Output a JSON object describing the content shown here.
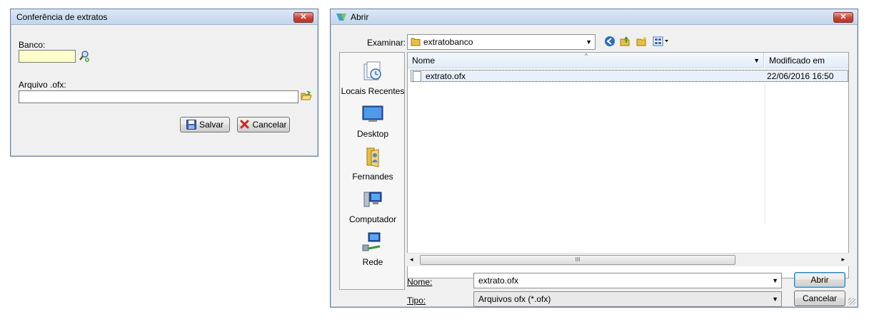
{
  "dialog1": {
    "title": "Conferência de extratos",
    "close": "✕",
    "banco_label": "Banco:",
    "banco_value": "",
    "arquivo_label": "Arquivo .ofx:",
    "arquivo_value": "",
    "save_label": "Salvar",
    "cancel_label": "Cancelar"
  },
  "dialog2": {
    "title": "Abrir",
    "close": "✕",
    "examinar_label": "Examinar:",
    "folder": "extratobanco",
    "places": [
      "Locais Recentes",
      "Desktop",
      "Fernandes",
      "Computador",
      "Rede"
    ],
    "columns": {
      "name": "Nome",
      "modified": "Modificado em"
    },
    "files": [
      {
        "name": "extrato.ofx",
        "modified": "22/06/2016 16:50"
      }
    ],
    "hscroll_grip": "III",
    "name_label": "Nome:",
    "name_value": "extrato.ofx",
    "type_label": "Tipo:",
    "type_value": "Arquivos ofx (*.ofx)",
    "open_label": "Abrir",
    "cancel_label": "Cancelar"
  }
}
